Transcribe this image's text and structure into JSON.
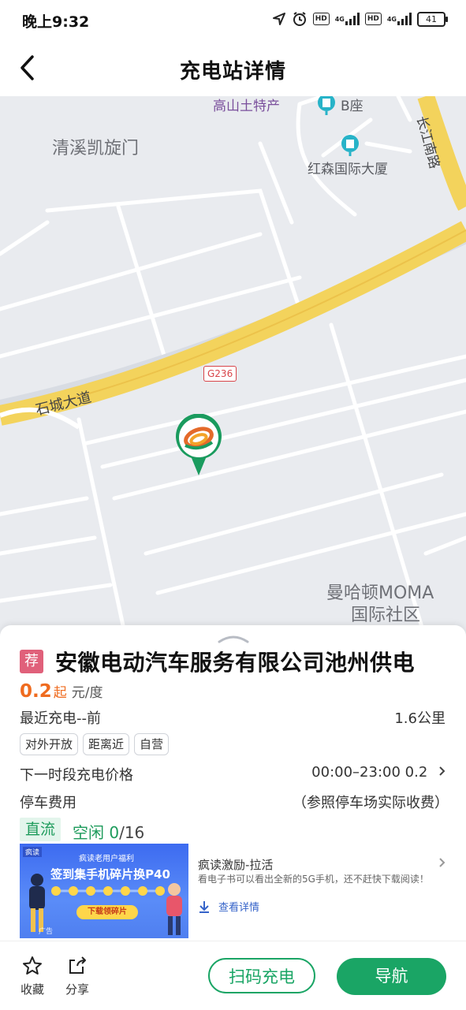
{
  "status_bar": {
    "time": "晚上9:32",
    "network1": "4G",
    "network2": "4G",
    "hd1": "HD",
    "hd2": "HD",
    "battery": "41"
  },
  "header": {
    "title": "充电站详情"
  },
  "map": {
    "labels": {
      "gaoshan": "高山土特产",
      "bzuo": "B座",
      "qingxi": "清溪凯旋门",
      "changjiang": "长江南路",
      "hongsen": "红森国际大厦",
      "shicheng": "石城大道",
      "g236": "G236",
      "manhattan1": "曼哈顿MOMA",
      "manhattan2": "国际社区"
    }
  },
  "station": {
    "badge": "荐",
    "name": "安徽电动汽车服务有限公司池州供电",
    "price": "0.2",
    "price_qi": "起",
    "price_unit": "元/度",
    "recent_charge": "最近充电--前",
    "distance": "1.6公里",
    "tags": [
      "对外开放",
      "距离近",
      "自营"
    ],
    "next_price_label": "下一时段充电价格",
    "next_price_value": "00:00–23:00 0.2",
    "parking_label": "停车费用",
    "parking_value": "（参照停车场实际收费）",
    "dc_label": "直流",
    "idle_label": "空闲",
    "idle_count": "0",
    "idle_total": "/16"
  },
  "ad": {
    "logo": "疯读",
    "line1": "疯读老用户福利",
    "line2": "签到集手机碎片换P40",
    "button": "下载领碎片",
    "mark": "广告",
    "title": "疯读激励-拉活",
    "desc": "看电子书可以看出全新的5G手机，还不赶快下载阅读！",
    "detail": "查看详情"
  },
  "bottom_bar": {
    "favorite": "收藏",
    "share": "分享",
    "scan": "扫码充电",
    "navigate": "导航"
  },
  "colors": {
    "accent_green": "#1aa565",
    "price_orange": "#ef6b1f",
    "badge_pink": "#e0607a"
  }
}
